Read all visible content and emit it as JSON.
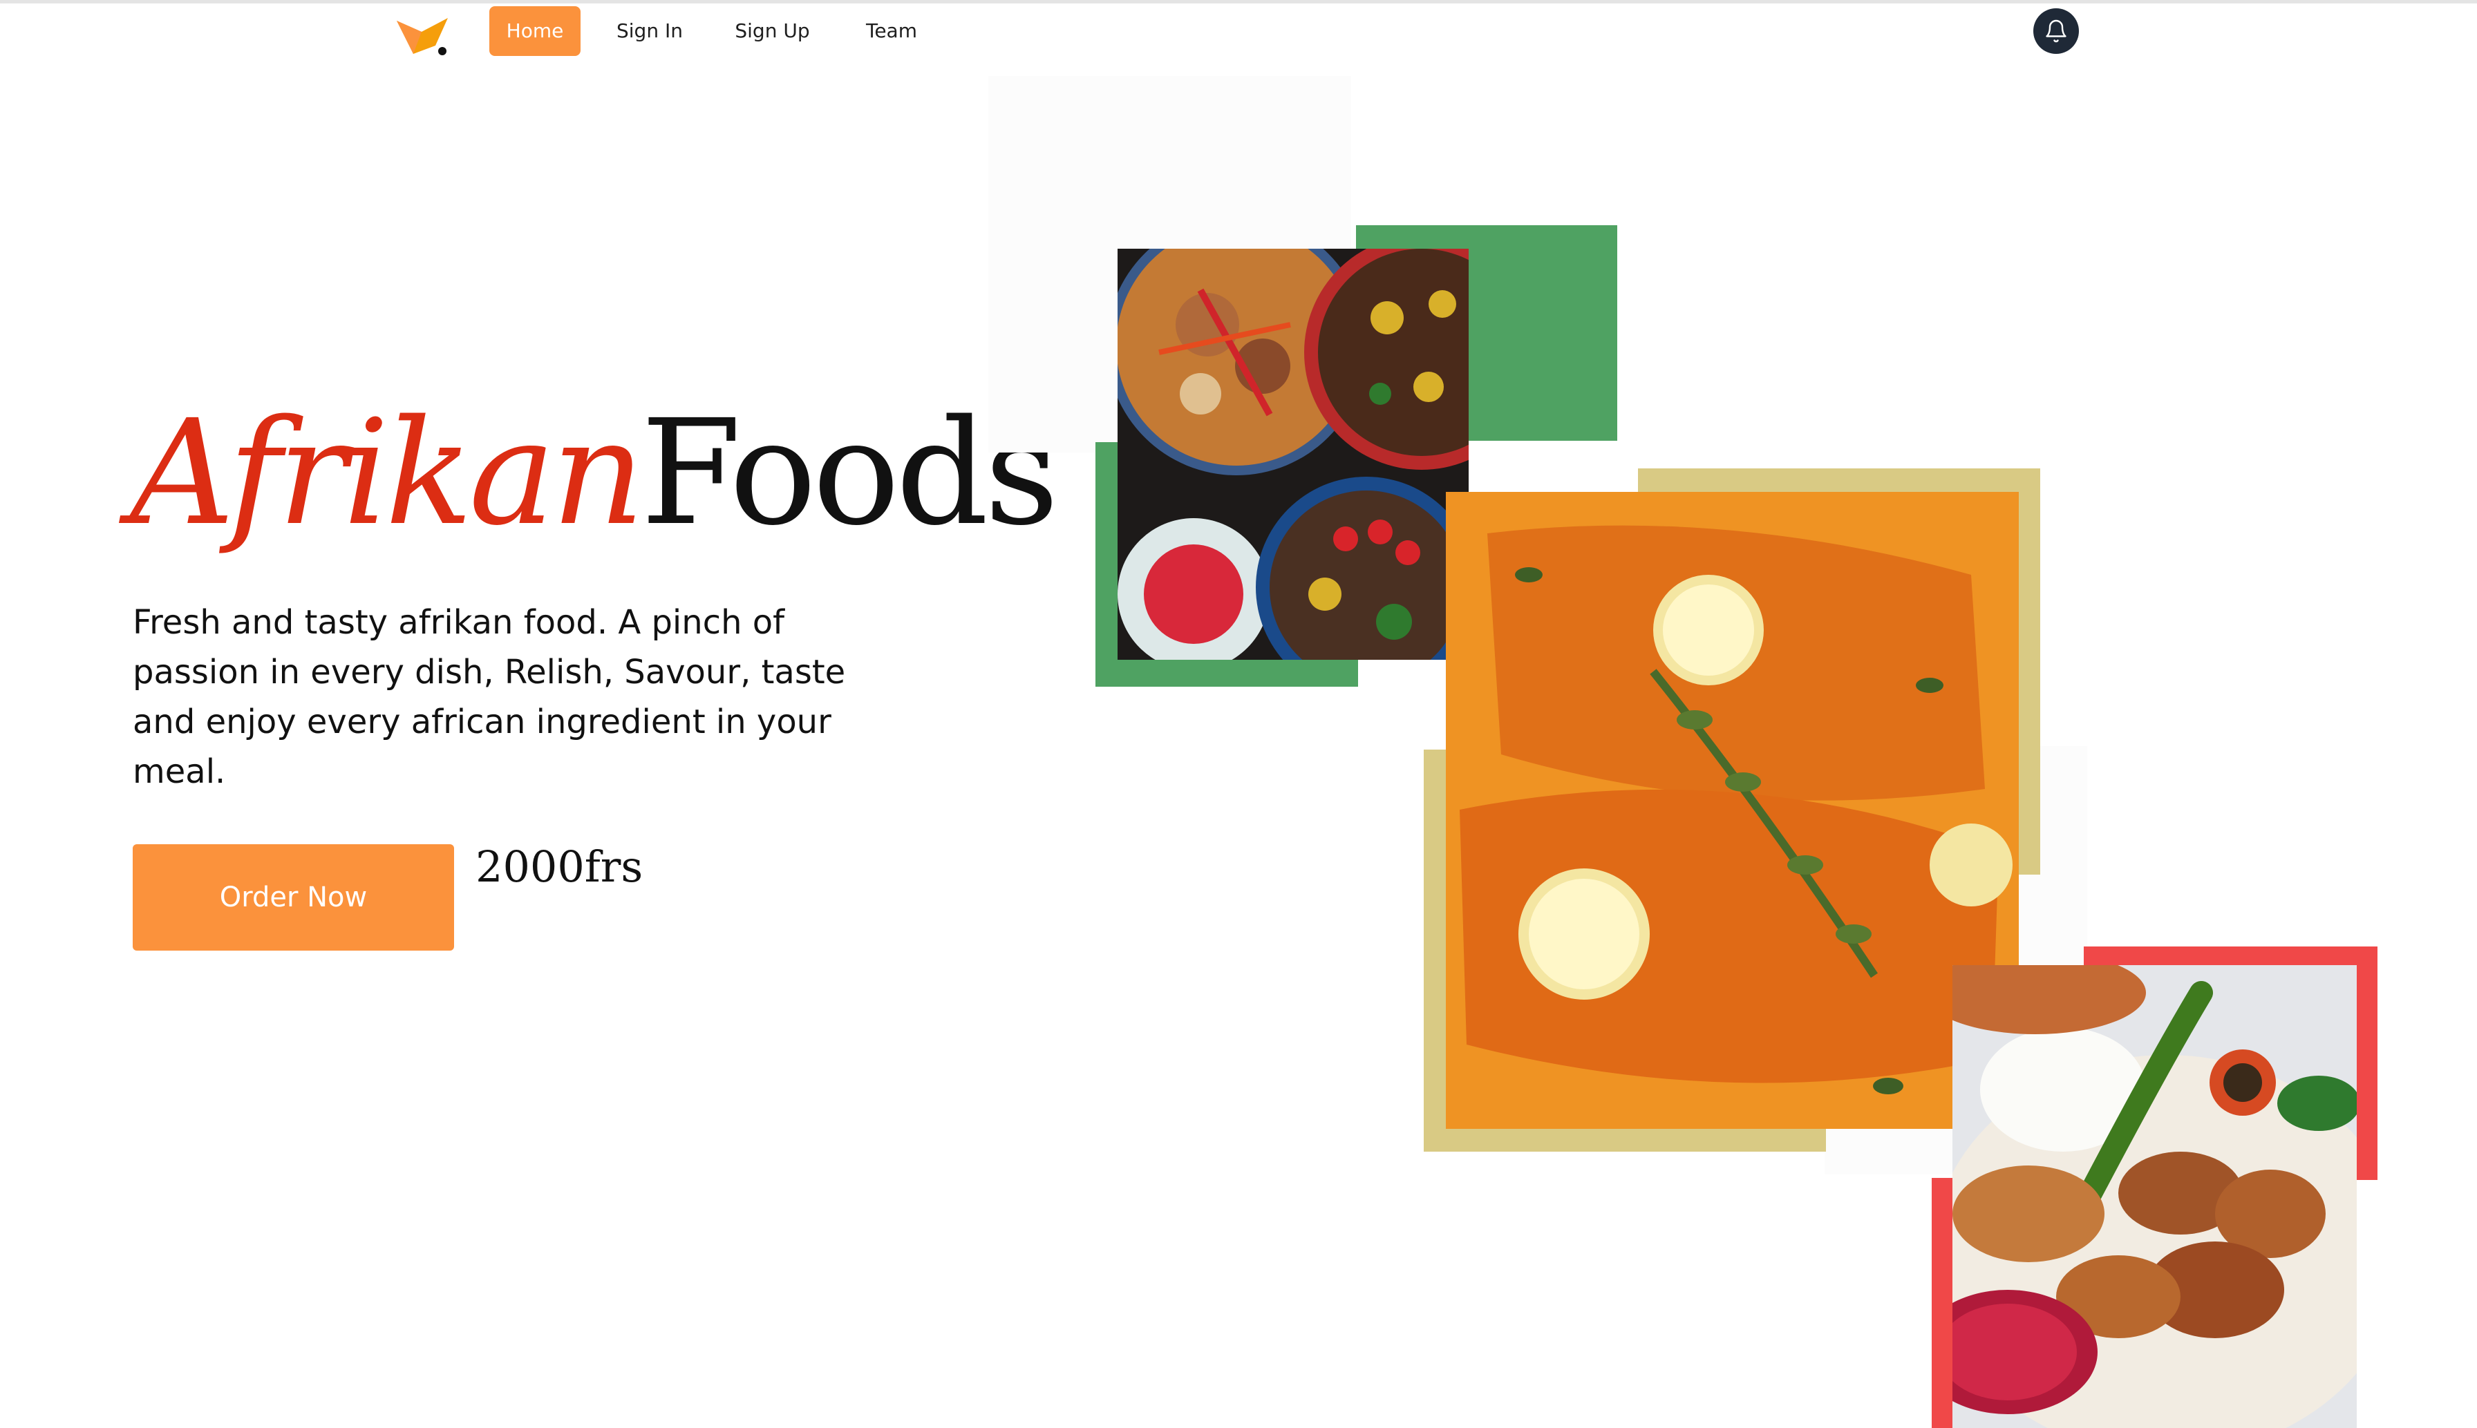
{
  "nav": {
    "logo_icon": "fox-logo-icon",
    "items": [
      {
        "label": "Home",
        "active": true
      },
      {
        "label": "Sign In",
        "active": false
      },
      {
        "label": "Sign Up",
        "active": false
      },
      {
        "label": "Team",
        "active": false
      }
    ],
    "notification_icon": "bell-icon"
  },
  "hero": {
    "title_part1": "Afrikan",
    "title_part2": "Foods",
    "description": "Fresh and tasty afrikan food. A pinch of passion in every dish, Relish, Savour, taste and enjoy every african ingredient in your meal.",
    "cta_label": "Order Now",
    "price": "2000frs"
  },
  "collage": {
    "images": [
      {
        "name": "african-dishes-photo",
        "frame_color": "#4fa262"
      },
      {
        "name": "salmon-curry-photo",
        "frame_color": "#d9ca84"
      },
      {
        "name": "grilled-chicken-photo",
        "frame_color": "#f04848"
      }
    ]
  },
  "colors": {
    "accent": "#fb923c",
    "title_red": "#dc2d13",
    "bell_bg": "#1f2937"
  }
}
